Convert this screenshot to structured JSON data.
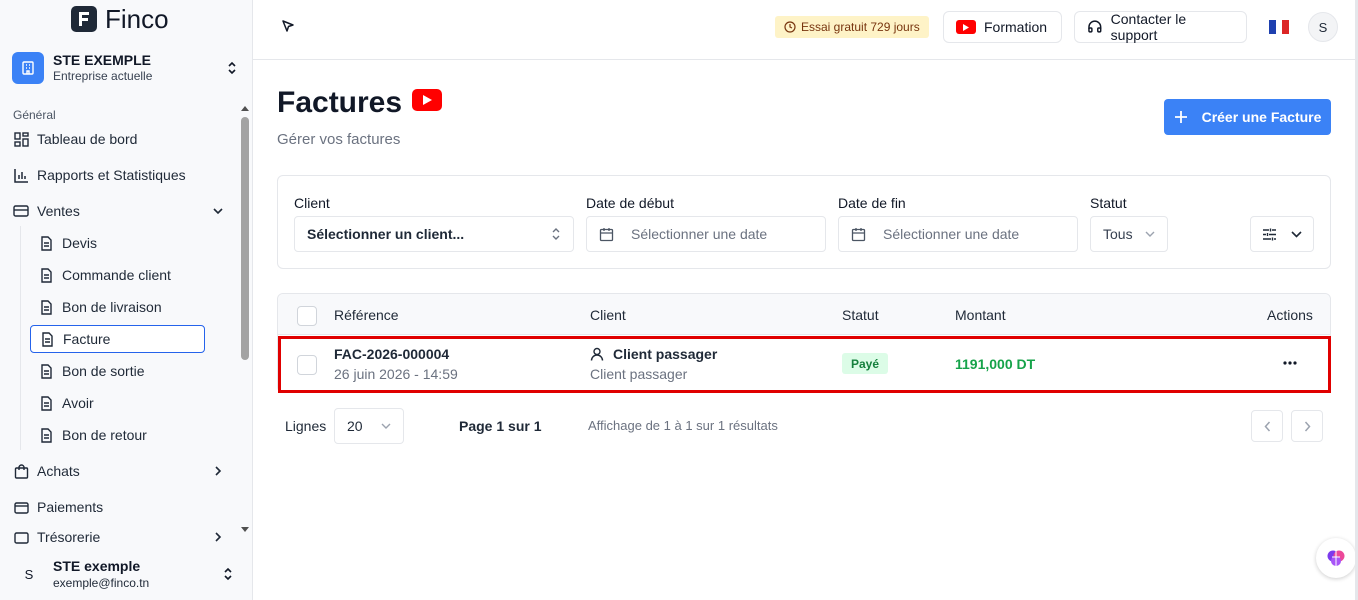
{
  "app": {
    "name": "Finco"
  },
  "company": {
    "name": "STE EXEMPLE",
    "subtitle": "Entreprise actuelle"
  },
  "sidebar": {
    "section": "Général",
    "items": [
      {
        "label": "Tableau de bord",
        "icon": "dashboard-icon"
      },
      {
        "label": "Rapports et Statistiques",
        "icon": "bar-chart-icon"
      },
      {
        "label": "Ventes",
        "icon": "wallet-icon",
        "expanded": true
      },
      {
        "label": "Achats",
        "icon": "shopping-bag-icon"
      },
      {
        "label": "Paiements",
        "icon": "payments-icon"
      },
      {
        "label": "Trésorerie",
        "icon": "treasury-icon"
      }
    ],
    "ventes_sub": [
      "Devis",
      "Commande client",
      "Bon de livraison",
      "Facture",
      "Bon de sortie",
      "Avoir",
      "Bon de retour"
    ],
    "active_sub": "Facture"
  },
  "user": {
    "initial": "S",
    "name": "STE exemple",
    "email": "exemple@finco.tn"
  },
  "topbar": {
    "trial": "Essai gratuit 729 jours",
    "formation": "Formation",
    "support": "Contacter le support",
    "avatar": "S"
  },
  "page": {
    "title": "Factures",
    "subtitle": "Gérer vos factures",
    "create_label": "Créer une Facture"
  },
  "filters": {
    "client_label": "Client",
    "client_value": "Sélectionner un client...",
    "start_label": "Date de début",
    "start_placeholder": "Sélectionner une date",
    "end_label": "Date de fin",
    "end_placeholder": "Sélectionner une date",
    "status_label": "Statut",
    "status_value": "Tous"
  },
  "table": {
    "columns": [
      "Référence",
      "Client",
      "Statut",
      "Montant",
      "Actions"
    ],
    "rows": [
      {
        "reference": "FAC-2026-000004",
        "date": "26 juin 2026 - 14:59",
        "client": "Client passager",
        "client_sub": "Client passager",
        "status": "Payé",
        "amount": "1191,000 DT"
      }
    ]
  },
  "pagination": {
    "rows_label": "Lignes",
    "rows_value": "20",
    "page_text": "Page 1 sur 1",
    "results_text": "Affichage de 1 à 1 sur 1 résultats"
  },
  "colors": {
    "accent": "#3b82f6",
    "paid": "#16a34a",
    "highlight": "#e00000",
    "youtube": "#ff0000"
  }
}
